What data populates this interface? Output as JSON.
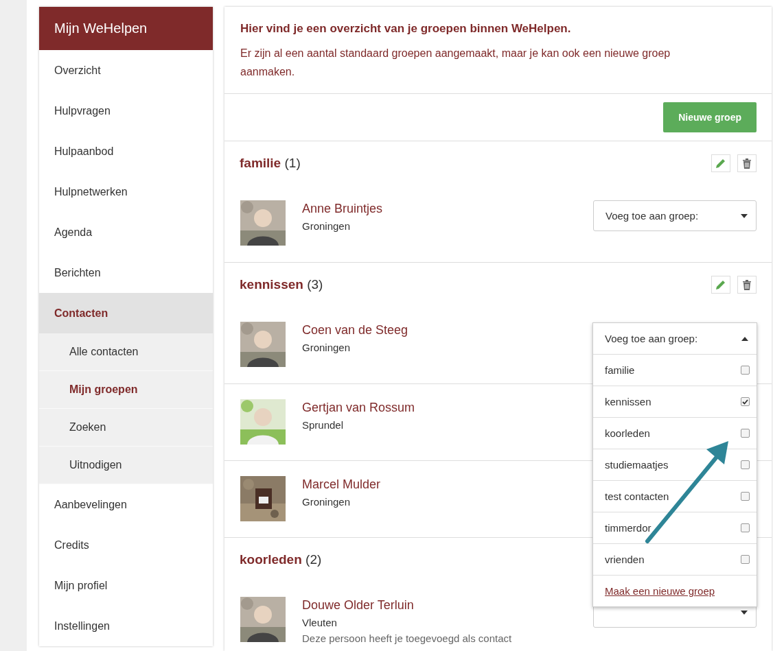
{
  "sidebar": {
    "title": "Mijn WeHelpen",
    "items": [
      {
        "label": "Overzicht",
        "selected": false
      },
      {
        "label": "Hulpvragen",
        "selected": false
      },
      {
        "label": "Hulpaanbod",
        "selected": false
      },
      {
        "label": "Hulpnetwerken",
        "selected": false
      },
      {
        "label": "Agenda",
        "selected": false
      },
      {
        "label": "Berichten",
        "selected": false
      },
      {
        "label": "Contacten",
        "selected": true,
        "children": [
          {
            "label": "Alle contacten",
            "selected": false
          },
          {
            "label": "Mijn groepen",
            "selected": true
          },
          {
            "label": "Zoeken",
            "selected": false
          },
          {
            "label": "Uitnodigen",
            "selected": false
          }
        ]
      },
      {
        "label": "Aanbevelingen",
        "selected": false
      },
      {
        "label": "Credits",
        "selected": false
      },
      {
        "label": "Mijn profiel",
        "selected": false
      },
      {
        "label": "Instellingen",
        "selected": false
      }
    ]
  },
  "intro": {
    "heading": "Hier vind je een overzicht van je groepen binnen WeHelpen.",
    "text": "Er zijn al een aantal standaard groepen aangemaakt, maar je kan ook een nieuwe groep aanmaken."
  },
  "new_group_button": "Nieuwe groep",
  "groups": [
    {
      "name": "familie",
      "count": "(1)",
      "contacts": [
        {
          "name": "Anne Bruintjes",
          "city": "Groningen",
          "select": "Voeg toe aan groep:"
        }
      ]
    },
    {
      "name": "kennissen",
      "count": "(3)",
      "contacts": [
        {
          "name": "Coen van de Steeg",
          "city": "Groningen",
          "select": "Voeg toe aan groep:",
          "open": true
        },
        {
          "name": "Gertjan van Rossum",
          "city": "Sprundel"
        },
        {
          "name": "Marcel Mulder",
          "city": "Groningen"
        }
      ]
    },
    {
      "name": "koorleden",
      "count": "(2)",
      "contacts": [
        {
          "name": "Douwe Older Terluin",
          "city": "Vleuten",
          "note": "Deze persoon heeft je toegevoegd als contact",
          "select_box": true
        }
      ]
    }
  ],
  "group_menu": {
    "options": [
      {
        "label": "familie",
        "checked": false
      },
      {
        "label": "kennissen",
        "checked": true
      },
      {
        "label": "koorleden",
        "checked": false
      },
      {
        "label": "studiemaatjes",
        "checked": false
      },
      {
        "label": "test contacten",
        "checked": false
      },
      {
        "label": "timmerdor",
        "checked": false
      },
      {
        "label": "vrienden",
        "checked": false
      }
    ],
    "link": "Maak een nieuwe groep"
  }
}
